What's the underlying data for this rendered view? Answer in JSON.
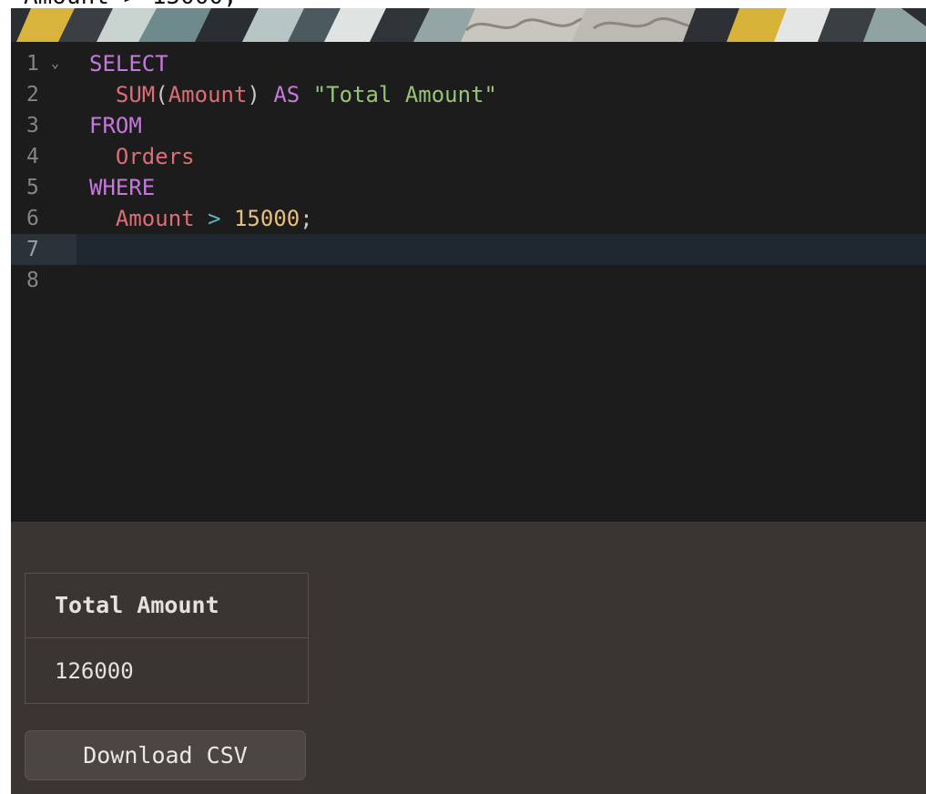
{
  "cut_text": "Amount > 15000;",
  "editor": {
    "lines": [
      {
        "n": "1",
        "fold": "⌄",
        "tokens": [
          {
            "t": "SELECT",
            "c": "kw"
          }
        ]
      },
      {
        "n": "2",
        "fold": "",
        "tokens": [
          {
            "t": "  ",
            "c": "pn"
          },
          {
            "t": "SUM",
            "c": "fn"
          },
          {
            "t": "(",
            "c": "pn"
          },
          {
            "t": "Amount",
            "c": "id"
          },
          {
            "t": ") ",
            "c": "pn"
          },
          {
            "t": "AS",
            "c": "kw"
          },
          {
            "t": " ",
            "c": "pn"
          },
          {
            "t": "\"Total Amount\"",
            "c": "str"
          }
        ]
      },
      {
        "n": "3",
        "fold": "",
        "tokens": [
          {
            "t": "FROM",
            "c": "kw"
          }
        ]
      },
      {
        "n": "4",
        "fold": "",
        "tokens": [
          {
            "t": "  ",
            "c": "pn"
          },
          {
            "t": "Orders",
            "c": "id"
          }
        ]
      },
      {
        "n": "5",
        "fold": "",
        "tokens": [
          {
            "t": "WHERE",
            "c": "kw"
          }
        ]
      },
      {
        "n": "6",
        "fold": "",
        "tokens": [
          {
            "t": "  ",
            "c": "pn"
          },
          {
            "t": "Amount",
            "c": "id"
          },
          {
            "t": " ",
            "c": "pn"
          },
          {
            "t": ">",
            "c": "op"
          },
          {
            "t": " ",
            "c": "pn"
          },
          {
            "t": "15000",
            "c": "num"
          },
          {
            "t": ";",
            "c": "pn"
          }
        ]
      },
      {
        "n": "7",
        "fold": "",
        "active": true,
        "tokens": []
      },
      {
        "n": "8",
        "fold": "",
        "tokens": []
      }
    ]
  },
  "results": {
    "columns": [
      "Total Amount"
    ],
    "rows": [
      [
        "126000"
      ]
    ]
  },
  "download_label": "Download CSV",
  "colors": {
    "keyword": "#c678dd",
    "identifier": "#e06c75",
    "string": "#98c379",
    "number": "#e5c07b",
    "operator": "#56b6c2",
    "editor_bg": "#1c1c1c",
    "panel_bg": "#3a3533"
  }
}
